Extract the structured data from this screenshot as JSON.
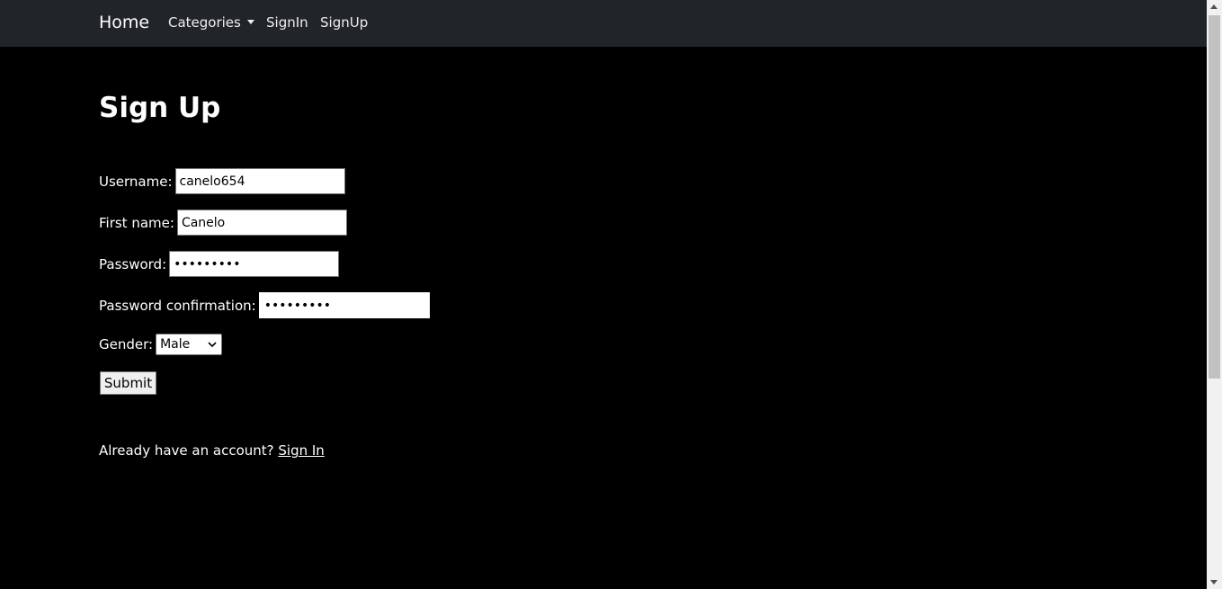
{
  "navbar": {
    "brand": "Home",
    "items": [
      {
        "label": "Categories",
        "dropdown": true
      },
      {
        "label": "SignIn"
      },
      {
        "label": "SignUp"
      }
    ]
  },
  "page": {
    "title": "Sign Up"
  },
  "form": {
    "username": {
      "label": "Username:",
      "value": "canelo654"
    },
    "first_name": {
      "label": "First name:",
      "value": "Canelo"
    },
    "password": {
      "label": "Password:",
      "value": "•••••••••"
    },
    "password_confirmation": {
      "label": "Password confirmation:",
      "value": "•••••••••"
    },
    "gender": {
      "label": "Gender:",
      "selected": "Male"
    },
    "submit_label": "Submit"
  },
  "footer": {
    "prompt": "Already have an account? ",
    "link_label": "Sign In"
  },
  "colors": {
    "navbar_bg": "#212529",
    "page_bg": "#000000",
    "text": "#ffffff"
  }
}
